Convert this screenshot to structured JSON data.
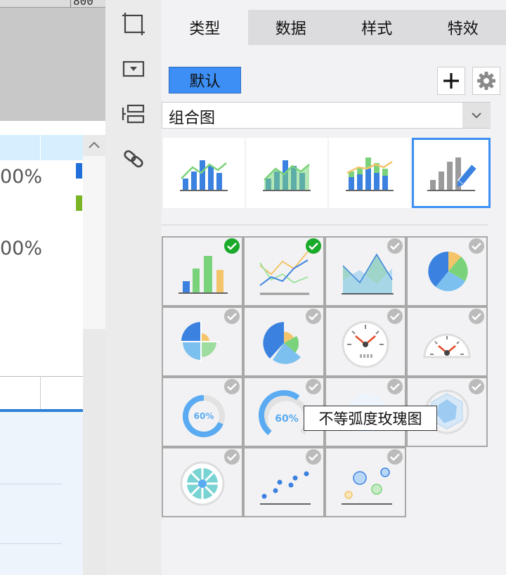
{
  "canvas": {
    "ruler_number": "800",
    "percent_1": "00%",
    "percent_2": "00%",
    "legend_colors": [
      "#1e6fd9",
      "#7ab526"
    ]
  },
  "toolbar": {
    "items": [
      {
        "name": "frame-icon"
      },
      {
        "name": "dropdown-widget-icon"
      },
      {
        "name": "list-layout-icon"
      },
      {
        "name": "link-icon"
      }
    ]
  },
  "tabs": [
    {
      "label": "类型",
      "active": true
    },
    {
      "label": "数据",
      "active": false
    },
    {
      "label": "样式",
      "active": false
    },
    {
      "label": "特效",
      "active": false
    }
  ],
  "default_button": {
    "label": "默认"
  },
  "chart_type_select": {
    "value": "组合图"
  },
  "combo_variants": [
    {
      "name": "bar-line-combo-icon"
    },
    {
      "name": "bar-line-area-combo-icon"
    },
    {
      "name": "stacked-bar-line-combo-icon"
    },
    {
      "name": "custom-combo-edit-icon",
      "selected": true
    }
  ],
  "chart_grid": [
    {
      "name": "bar-chart-icon",
      "checked": true
    },
    {
      "name": "line-chart-icon",
      "checked": true
    },
    {
      "name": "area-chart-icon",
      "checked": false
    },
    {
      "name": "pie-chart-icon",
      "checked": false
    },
    {
      "name": "rose-pie-chart-icon",
      "checked": false
    },
    {
      "name": "rose-pie-partial-icon",
      "checked": false
    },
    {
      "name": "gauge-dial-icon",
      "checked": false
    },
    {
      "name": "gauge-semicircle-icon",
      "checked": false
    },
    {
      "name": "ring-progress-icon",
      "checked": false,
      "label": "60%"
    },
    {
      "name": "arc-progress-icon",
      "checked": false,
      "label": "60%"
    },
    {
      "name": "unequal-arc-rose-icon",
      "checked": false
    },
    {
      "name": "radar-chart-icon",
      "checked": false
    },
    {
      "name": "radial-rose-icon",
      "checked": false
    },
    {
      "name": "scatter-chart-icon",
      "checked": false
    },
    {
      "name": "bubble-chart-icon",
      "checked": false
    }
  ],
  "tooltip": {
    "text": "不等弧度玫瑰图"
  },
  "colors": {
    "accent": "#3d8ff5",
    "check_active": "#1aaa2a",
    "check_inactive": "#bbbbbb"
  }
}
